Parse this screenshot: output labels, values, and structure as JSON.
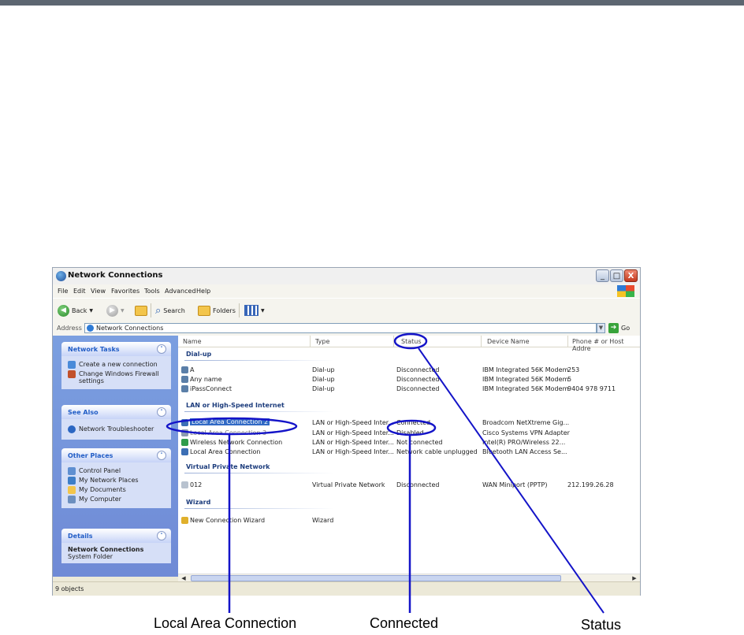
{
  "window": {
    "title": "Network Connections",
    "controls": {
      "minimize": "_",
      "maximize": "□",
      "close": "X"
    }
  },
  "menu": [
    "File",
    "Edit",
    "View",
    "Favorites",
    "Tools",
    "Advanced",
    "Help"
  ],
  "toolbar": {
    "back": "Back",
    "search": "Search",
    "folders": "Folders"
  },
  "address": {
    "label": "Address",
    "value": "Network Connections",
    "go": "Go"
  },
  "sidebar": {
    "network_tasks": {
      "title": "Network Tasks",
      "items": [
        "Create a new connection",
        "Change Windows Firewall settings"
      ]
    },
    "see_also": {
      "title": "See Also",
      "items": [
        "Network Troubleshooter"
      ]
    },
    "other_places": {
      "title": "Other Places",
      "items": [
        "Control Panel",
        "My Network Places",
        "My Documents",
        "My Computer"
      ]
    },
    "details": {
      "title": "Details",
      "name": "Network Connections",
      "sub": "System Folder"
    }
  },
  "columns": [
    "Name",
    "Type",
    "Status",
    "Device Name",
    "Phone # or Host Addre"
  ],
  "groups": {
    "dialup": {
      "title": "Dial-up",
      "rows": [
        [
          "A",
          "Dial-up",
          "Disconnected",
          "IBM Integrated 56K Modem",
          "253"
        ],
        [
          "Any name",
          "Dial-up",
          "Disconnected",
          "IBM Integrated 56K Modem",
          "5"
        ],
        [
          "iPassConnect",
          "Dial-up",
          "Disconnected",
          "IBM Integrated 56K Modem",
          "9404 978 9711"
        ]
      ]
    },
    "lan": {
      "title": "LAN or High-Speed Internet",
      "rows": [
        [
          "Local Area Connection 2",
          "LAN or High-Speed Inter...",
          "Connected",
          "Broadcom NetXtreme Gig...",
          ""
        ],
        [
          "Local Area Connection 3",
          "LAN or High-Speed Inter...",
          "Disabled",
          "Cisco Systems VPN Adapter",
          ""
        ],
        [
          "Wireless Network Connection",
          "LAN or High-Speed Inter...",
          "Not connected",
          "Intel(R) PRO/Wireless 22...",
          ""
        ],
        [
          "Local Area Connection",
          "LAN or High-Speed Inter...",
          "Network cable unplugged",
          "Bluetooth LAN Access Se...",
          ""
        ]
      ]
    },
    "vpn": {
      "title": "Virtual Private Network",
      "rows": [
        [
          "012",
          "Virtual Private Network",
          "Disconnected",
          "WAN Miniport (PPTP)",
          "212.199.26.28"
        ]
      ]
    },
    "wizard": {
      "title": "Wizard",
      "rows": [
        [
          "New Connection Wizard",
          "Wizard",
          "",
          "",
          ""
        ]
      ]
    }
  },
  "status_bar": "9 objects",
  "annotations": {
    "local_area_connection": "Local Area Connection",
    "connected": "Connected",
    "status": "Status"
  },
  "colors": {
    "top_bar": "#5d6671",
    "annotation_blue": "#1414c8",
    "sidebar_blue": "#7b9fe0",
    "selection_blue": "#316ac5"
  }
}
